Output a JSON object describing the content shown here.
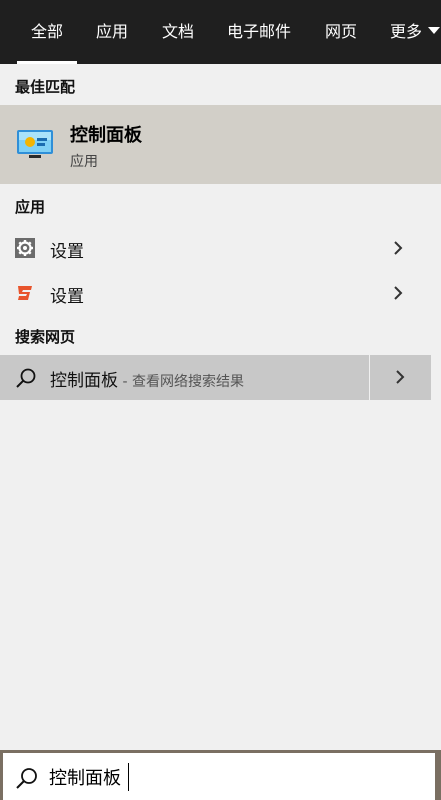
{
  "tabs": [
    {
      "label": "全部",
      "active": true
    },
    {
      "label": "应用"
    },
    {
      "label": "文档"
    },
    {
      "label": "电子邮件"
    },
    {
      "label": "网页"
    },
    {
      "label": "更多"
    }
  ],
  "sections": {
    "best_match": "最佳匹配",
    "apps": "应用",
    "web": "搜索网页"
  },
  "best_match": {
    "title": "控制面板",
    "subtitle": "应用"
  },
  "apps": [
    {
      "label": "设置",
      "icon": "gear-icon"
    },
    {
      "label": "设置",
      "icon": "sogou-s-icon"
    }
  ],
  "web_search": {
    "query": "控制面板",
    "hint": " - 查看网络搜索结果"
  },
  "search": {
    "value": "控制面板"
  },
  "colors": {
    "tabbar_bg": "#1f1f1f",
    "best_match_bg": "#d2cfc8",
    "web_row_bg": "#c8c8c8",
    "search_frame": "#7a6f62"
  }
}
